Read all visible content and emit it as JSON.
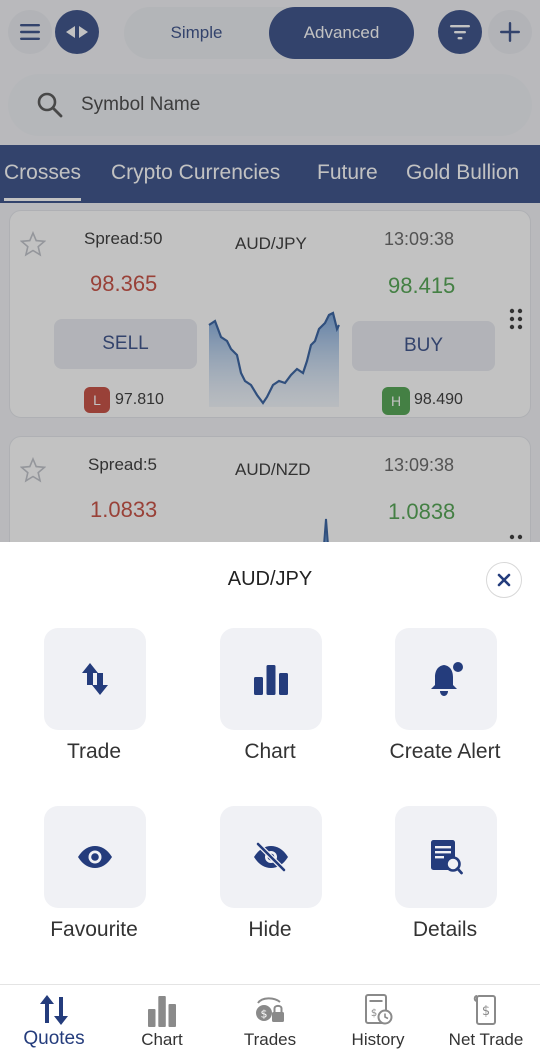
{
  "header": {
    "segment": {
      "simple_label": "Simple",
      "advanced_label": "Advanced",
      "selected": "Advanced"
    },
    "icons": {
      "menu": "hamburger-icon",
      "swap": "swap-arrows-icon",
      "filter": "filter-icon",
      "add": "plus-icon"
    }
  },
  "search": {
    "placeholder": "Symbol Name"
  },
  "tabs": [
    {
      "label": "Crosses",
      "active": true
    },
    {
      "label": "Crypto Currencies",
      "active": false
    },
    {
      "label": "Future",
      "active": false
    },
    {
      "label": "Gold Bullion",
      "active": false
    }
  ],
  "quotes": [
    {
      "symbol": "AUD/JPY",
      "spread": "Spread:50",
      "time": "13:09:38",
      "bid": "98.365",
      "ask": "98.415",
      "sell_label": "SELL",
      "buy_label": "BUY",
      "low_badge": "L",
      "low": "97.810",
      "high_badge": "H",
      "high": "98.490"
    },
    {
      "symbol": "AUD/NZD",
      "spread": "Spread:5",
      "time": "13:09:38",
      "bid": "1.0833",
      "ask": "1.0838"
    }
  ],
  "sheet": {
    "title": "AUD/JPY",
    "actions": [
      {
        "label": "Trade",
        "icon": "trade-arrows-icon"
      },
      {
        "label": "Chart",
        "icon": "bar-chart-icon"
      },
      {
        "label": "Create Alert",
        "icon": "bell-icon"
      },
      {
        "label": "Favourite",
        "icon": "eye-icon"
      },
      {
        "label": "Hide",
        "icon": "eye-slash-icon"
      },
      {
        "label": "Details",
        "icon": "document-search-icon"
      }
    ]
  },
  "bottom_nav": [
    {
      "label": "Quotes",
      "icon": "sort-arrows-icon",
      "active": true
    },
    {
      "label": "Chart",
      "icon": "bar-chart-icon",
      "active": false
    },
    {
      "label": "Trades",
      "icon": "trades-icon",
      "active": false
    },
    {
      "label": "History",
      "icon": "receipt-clock-icon",
      "active": false
    },
    {
      "label": "Net Trade",
      "icon": "dollar-receipt-icon",
      "active": false
    }
  ],
  "colors": {
    "primary": "#243c7c",
    "bid_red": "#c0392b",
    "ask_green": "#3e9a3e"
  }
}
